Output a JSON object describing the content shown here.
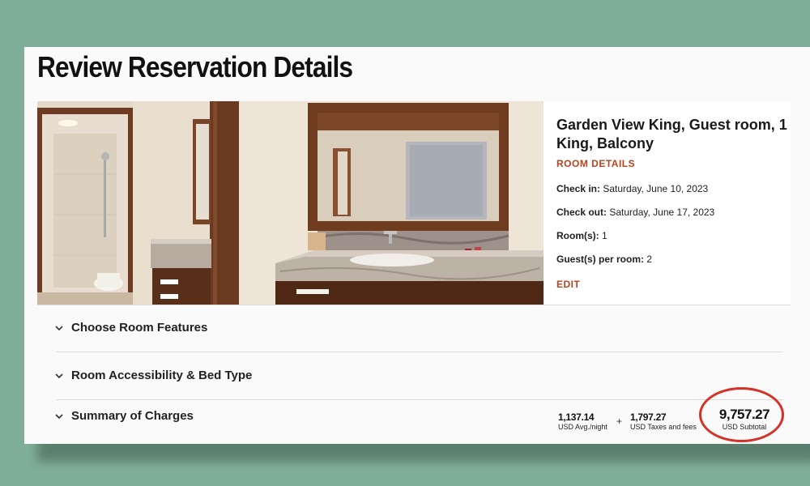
{
  "page_title": "Review Reservation Details",
  "room": {
    "name": "Garden View King, Guest room, 1 King, Balcony",
    "details_link": "ROOM DETAILS",
    "check_in_label": "Check in:",
    "check_in_value": "Saturday, June 10, 2023",
    "check_out_label": "Check out:",
    "check_out_value": "Saturday, June 17, 2023",
    "rooms_label": "Room(s):",
    "rooms_value": "1",
    "guests_label": "Guest(s) per room:",
    "guests_value": "2",
    "edit_link": "EDIT"
  },
  "sections": [
    {
      "label": "Choose Room Features",
      "icon": "chevron-down-icon"
    },
    {
      "label": "Room Accessibility & Bed Type",
      "icon": "chevron-down-icon"
    },
    {
      "label": "Summary of Charges",
      "icon": "chevron-down-icon"
    }
  ],
  "charges": {
    "avg_night_amount": "1,137.14",
    "avg_night_label": "USD Avg./night",
    "plus": "+",
    "taxes_amount": "1,797.27",
    "taxes_label": "USD Taxes and fees",
    "subtotal_amount": "9,757.27",
    "subtotal_label": "USD Subtotal"
  },
  "colors": {
    "background": "#7fae98",
    "accent_link": "#b5441e",
    "highlight_circle": "#d43226"
  }
}
